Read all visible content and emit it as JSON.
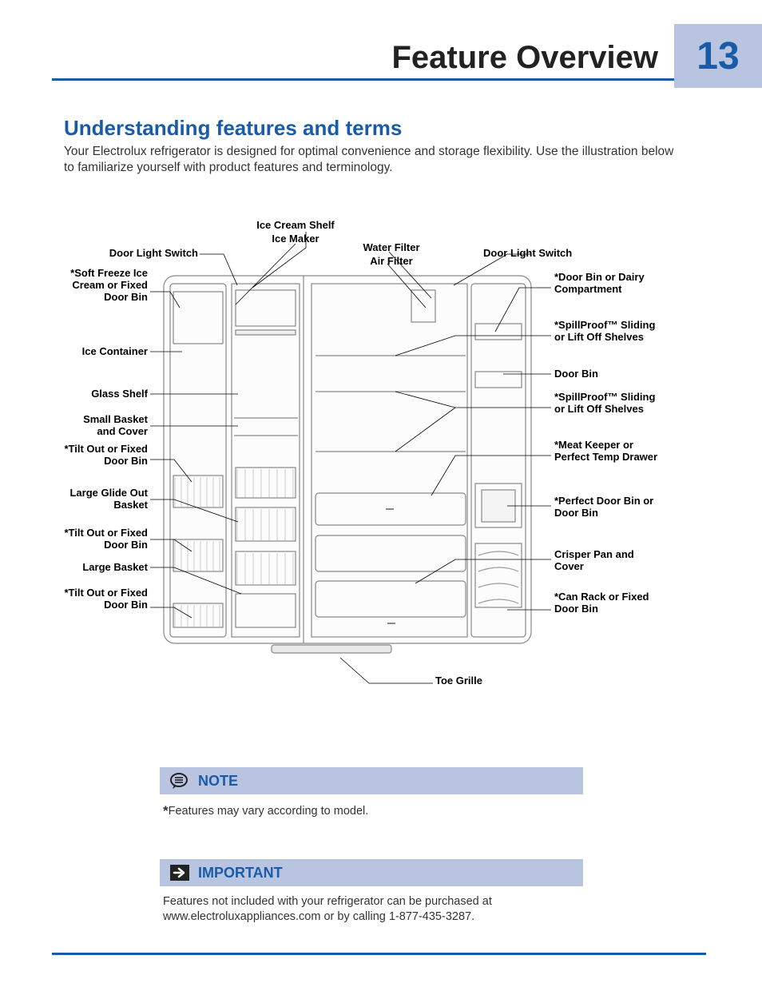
{
  "page": {
    "number": "13",
    "title": "Feature Overview"
  },
  "section": {
    "title": "Understanding features and terms",
    "intro": "Your Electrolux refrigerator is designed for optimal convenience and storage flexibility. Use the illustration below to familiarize yourself with product features and terminology."
  },
  "diagram": {
    "labels_top": {
      "ice_cream_shelf": "Ice Cream Shelf",
      "ice_maker": "Ice Maker",
      "water_filter": "Water Filter",
      "air_filter": "Air Filter",
      "door_light_switch_left": "Door Light Switch",
      "door_light_switch_right": "Door Light Switch"
    },
    "labels_left": {
      "soft_freeze": "*Soft Freeze Ice Cream or Fixed Door Bin",
      "ice_container": "Ice Container",
      "glass_shelf": "Glass Shelf",
      "small_basket": "Small Basket and Cover",
      "tilt_out_1": "*Tilt Out or Fixed Door Bin",
      "large_glide": "Large Glide Out Basket",
      "tilt_out_2": "*Tilt Out or Fixed Door Bin",
      "large_basket": "Large Basket",
      "tilt_out_3": "*Tilt Out or Fixed Door Bin"
    },
    "labels_right": {
      "door_bin_dairy": "*Door Bin or Dairy Compartment",
      "spillproof_1": "*SpillProof™ Sliding or Lift Off Shelves",
      "door_bin": "Door Bin",
      "spillproof_2": "*SpillProof™ Sliding or Lift Off Shelves",
      "meat_keeper": "*Meat Keeper or Perfect Temp Drawer",
      "perfect_door_bin": "*Perfect Door Bin or Door Bin",
      "crisper": "Crisper Pan and Cover",
      "can_rack": "*Can Rack or Fixed Door Bin"
    },
    "labels_bottom": {
      "toe_grille": "Toe Grille"
    }
  },
  "callouts": {
    "note": {
      "title": "NOTE",
      "body": "Features may vary according to model."
    },
    "important": {
      "title": "IMPORTANT",
      "body": "Features not included with your refrigerator can be purchased at www.electroluxappliances.com or by calling 1-877-435-3287."
    }
  }
}
